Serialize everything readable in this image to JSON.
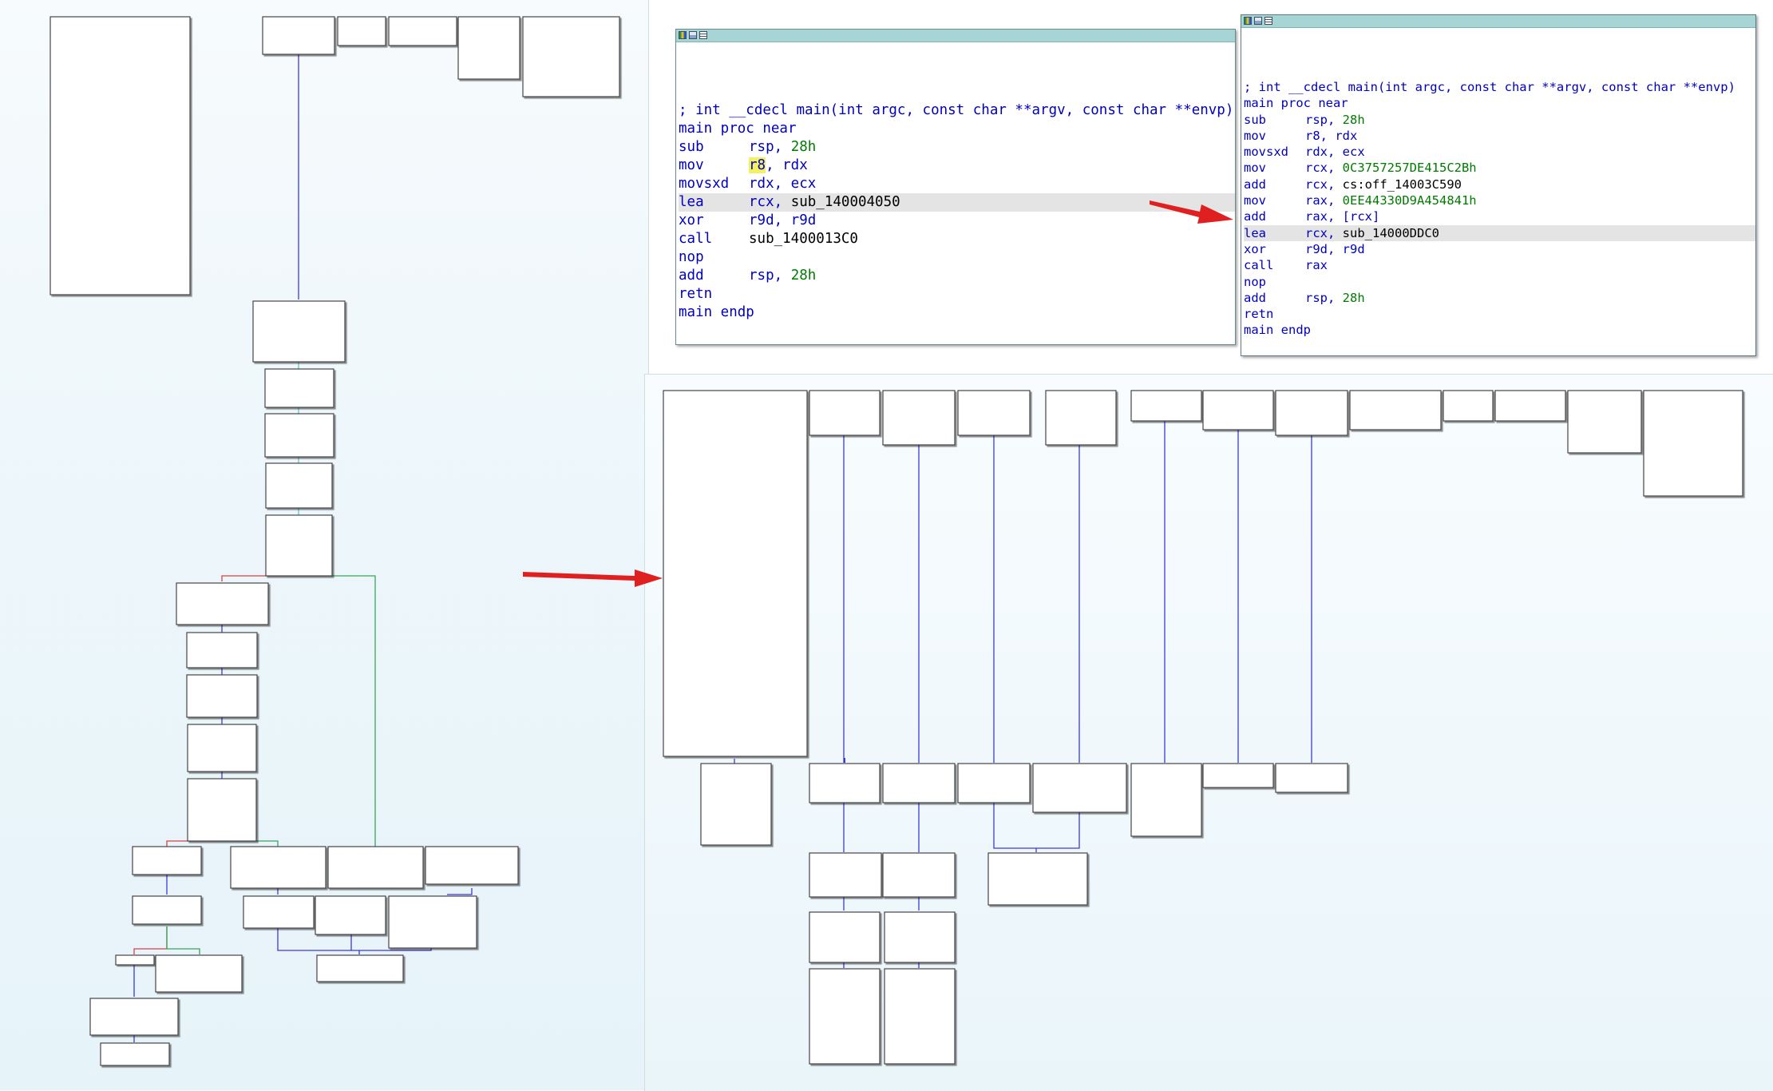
{
  "colors": {
    "edge_normal": "#3b3bd9",
    "edge_true": "#3aa55a",
    "edge_false": "#d04545",
    "titlebar": "#a7d5d6",
    "highlight": "#e4e4e4",
    "annotation_arrow": "#e02020"
  },
  "titlebar_icons": [
    "graph-overview-icon",
    "image-icon",
    "listing-icon"
  ],
  "before_window": {
    "lines": [
      {
        "mnemonic": "",
        "operands": "",
        "comment": "; int __cdecl main(int argc, const char **argv, const char **envp)"
      },
      {
        "mnemonic": "main proc near",
        "operands": ""
      },
      {
        "mnemonic": "sub",
        "operands_prefix": "rsp, ",
        "num": "28h"
      },
      {
        "mnemonic": "mov",
        "reg_highlight": "r8",
        "operands_suffix": ", rdx"
      },
      {
        "mnemonic": "movsxd",
        "operands_prefix": "rdx, ecx"
      },
      {
        "mnemonic": "lea",
        "operands_prefix": "rcx, ",
        "name": "sub_140004050"
      },
      {
        "mnemonic": "xor",
        "operands_prefix": "r9d, r9d"
      },
      {
        "mnemonic": "call",
        "operands_prefix": "",
        "name": "sub_1400013C0"
      },
      {
        "mnemonic": "nop",
        "operands_prefix": ""
      },
      {
        "mnemonic": "add",
        "operands_prefix": "rsp, ",
        "num": "28h"
      },
      {
        "mnemonic": "retn",
        "operands_prefix": ""
      },
      {
        "mnemonic": "main endp",
        "operands_prefix": ""
      }
    ]
  },
  "after_window": {
    "lines": [
      {
        "mnemonic": "",
        "comment": "; int __cdecl main(int argc, const char **argv, const char **envp)"
      },
      {
        "mnemonic": "main proc near",
        "operands_prefix": ""
      },
      {
        "mnemonic": "sub",
        "operands_prefix": "rsp, ",
        "num": "28h"
      },
      {
        "mnemonic": "mov",
        "operands_prefix": "r8, rdx"
      },
      {
        "mnemonic": "movsxd",
        "operands_prefix": "rdx, ecx"
      },
      {
        "mnemonic": "mov",
        "operands_prefix": "rcx, ",
        "num": "0C3757257DE415C2Bh"
      },
      {
        "mnemonic": "add",
        "operands_prefix": "rcx, ",
        "name": "cs:off_14003C590"
      },
      {
        "mnemonic": "mov",
        "operands_prefix": "rax, ",
        "num": "0EE44330D9A454841h"
      },
      {
        "mnemonic": "add",
        "operands_prefix": "rax, [rcx]"
      },
      {
        "mnemonic": "lea",
        "operands_prefix": "rcx, ",
        "name": "sub_14000DDC0"
      },
      {
        "mnemonic": "xor",
        "operands_prefix": "r9d, r9d"
      },
      {
        "mnemonic": "call",
        "operands_prefix": "rax"
      },
      {
        "mnemonic": "nop",
        "operands_prefix": ""
      },
      {
        "mnemonic": "add",
        "operands_prefix": "rsp, ",
        "num": "28h"
      },
      {
        "mnemonic": "retn",
        "operands_prefix": ""
      },
      {
        "mnemonic": "main endp",
        "operands_prefix": ""
      }
    ]
  }
}
